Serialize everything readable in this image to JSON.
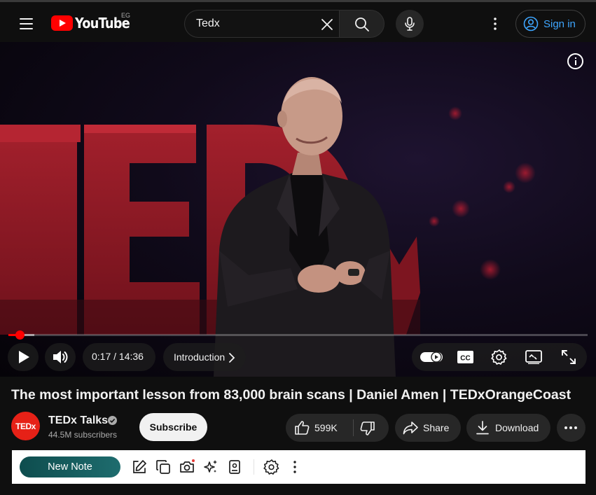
{
  "header": {
    "logo_text": "YouTube",
    "logo_country": "EG",
    "search_value": "Tedx",
    "search_placeholder": "Search",
    "signin_label": "Sign in"
  },
  "player": {
    "current_time": "0:17",
    "duration": "14:36",
    "time_display": "0:17 / 14:36",
    "chapter": "Introduction",
    "progress_fraction": 0.019,
    "stage_text": "TEDx",
    "accent_color": "#ff0000"
  },
  "video": {
    "title": "The most important lesson from 83,000 brain scans | Daniel Amen | TEDxOrangeCoast"
  },
  "channel": {
    "name": "TEDx Talks",
    "avatar_text": "TEDx",
    "subscribers": "44.5M subscribers",
    "subscribe_label": "Subscribe",
    "verified": true
  },
  "actions": {
    "likes": "599K",
    "share_label": "Share",
    "download_label": "Download"
  },
  "note_toolbar": {
    "new_note_label": "New Note",
    "tools": [
      "edit-icon",
      "copy-icon",
      "camera-icon",
      "sparkle-icon",
      "contact-card-icon",
      "gear-icon",
      "more-vertical-icon"
    ]
  }
}
